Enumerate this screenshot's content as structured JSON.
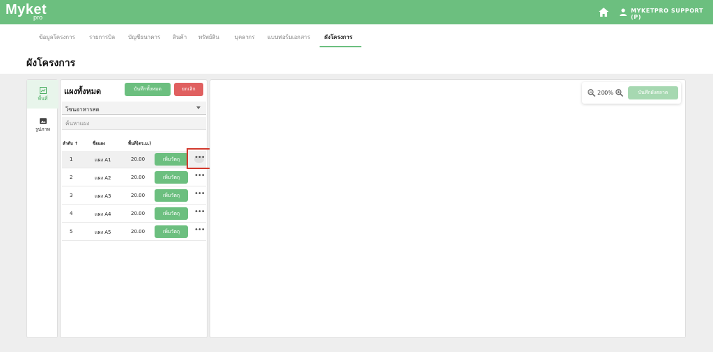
{
  "header": {
    "logo_text": "Myket",
    "logo_sub": "pro",
    "user_name": "MYKETPRO SUPPORT (P)",
    "accent_color": "#6cbf7f"
  },
  "tabs": [
    {
      "label": "ข้อมูลโครงการ"
    },
    {
      "label": "รายการบิล"
    },
    {
      "label": "บัญชีธนาคาร"
    },
    {
      "label": "สินค้า"
    },
    {
      "label": "ทรัพย์สิน"
    },
    {
      "label": "บุคลากร"
    },
    {
      "label": "แบบฟอร์มเอกสาร"
    },
    {
      "label": "ผังโครงการ",
      "active": true
    }
  ],
  "page": {
    "title": "ผังโครงการ"
  },
  "side_nav": [
    {
      "label": "พื้นที่",
      "icon": "area-icon",
      "active": true
    },
    {
      "label": "รูปภาพ",
      "icon": "image-icon",
      "active": false
    }
  ],
  "panel": {
    "title": "แผงทั้งหมด",
    "save_all_label": "บันทึกทั้งหมด",
    "cancel_label": "ยกเลิก",
    "zone_value": "โซนอาหารสด",
    "search_placeholder": "ค้นหาแผง",
    "columns": {
      "order": "ลำดับ ↑",
      "name": "ชื่อแผง",
      "area": "พื้นที่(ตร.ม.)"
    },
    "rows": [
      {
        "order": "1",
        "name": "แผง A1",
        "area": "20.00",
        "action": "เพิ่มวัตถุ"
      },
      {
        "order": "2",
        "name": "แผง A2",
        "area": "20.00",
        "action": "เพิ่มวัตถุ"
      },
      {
        "order": "3",
        "name": "แผง A3",
        "area": "20.00",
        "action": "เพิ่มวัตถุ"
      },
      {
        "order": "4",
        "name": "แผง A4",
        "area": "20.00",
        "action": "เพิ่มวัตถุ"
      },
      {
        "order": "5",
        "name": "แผง A5",
        "area": "20.00",
        "action": "เพิ่มวัตถุ"
      }
    ]
  },
  "canvas": {
    "zoom": "200%",
    "save_layout_label": "บันทึกผังตลาด"
  }
}
